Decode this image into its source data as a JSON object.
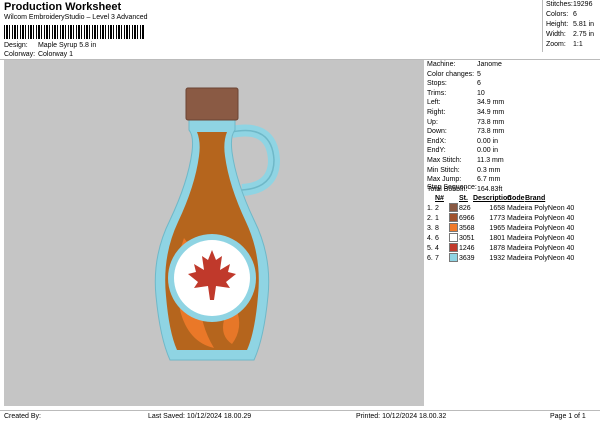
{
  "header": {
    "title": "Production Worksheet",
    "subtitle": "Wilcom EmbroideryStudio – Level 3 Advanced",
    "design_label": "Design:",
    "design_value": "Maple Syrup 5.8 in",
    "colorway_label": "Colorway:",
    "colorway_value": "Colorway 1"
  },
  "stats": [
    {
      "label": "Stitches:",
      "value": "19296"
    },
    {
      "label": "Colors:",
      "value": "6"
    },
    {
      "label": "Height:",
      "value": "5.81 in"
    },
    {
      "label": "Width:",
      "value": "2.75 in"
    },
    {
      "label": "Zoom:",
      "value": "1:1"
    }
  ],
  "info": [
    {
      "label": "Machine:",
      "value": "Janome"
    },
    {
      "label": "Color changes:",
      "value": "5"
    },
    {
      "label": "Stops:",
      "value": "6"
    },
    {
      "label": "Trims:",
      "value": "10"
    },
    {
      "label": "Left:",
      "value": "34.9 mm"
    },
    {
      "label": "Right:",
      "value": "34.9 mm"
    },
    {
      "label": "Up:",
      "value": "73.8 mm"
    },
    {
      "label": "Down:",
      "value": "73.8 mm"
    },
    {
      "label": "EndX:",
      "value": "0.00 in"
    },
    {
      "label": "EndY:",
      "value": "0.00 in"
    },
    {
      "label": "Max Stitch:",
      "value": "11.3 mm"
    },
    {
      "label": "Min Stitch:",
      "value": "0.3 mm"
    },
    {
      "label": "Max Jump:",
      "value": "6.7 mm"
    },
    {
      "label": "Total Bobbin:",
      "value": "164.83ft"
    }
  ],
  "sequence": {
    "title": "Stop Sequence:",
    "headers": [
      "N#",
      "St.",
      "Description",
      "Code",
      "Brand"
    ],
    "rows": [
      {
        "stop": "1.",
        "num": "2",
        "color": "#8a5a44",
        "code": "826",
        "stitches": "1658",
        "brand": "Madeira PolyNeon 40"
      },
      {
        "stop": "2.",
        "num": "1",
        "color": "#a0522d",
        "code": "6966",
        "stitches": "1773",
        "brand": "Madeira PolyNeon 40"
      },
      {
        "stop": "3.",
        "num": "8",
        "color": "#f07a2a",
        "code": "3568",
        "stitches": "1965",
        "brand": "Madeira PolyNeon 40"
      },
      {
        "stop": "4.",
        "num": "6",
        "color": "#ffffff",
        "code": "3051",
        "stitches": "1801",
        "brand": "Madeira PolyNeon 40"
      },
      {
        "stop": "5.",
        "num": "4",
        "color": "#c0392b",
        "code": "1246",
        "stitches": "1878",
        "brand": "Madeira PolyNeon 40"
      },
      {
        "stop": "6.",
        "num": "7",
        "color": "#8fd4e3",
        "code": "3639",
        "stitches": "1932",
        "brand": "Madeira PolyNeon 40"
      }
    ]
  },
  "footer": {
    "created": "Created By:",
    "saved": "Last Saved: 10/12/2024 18.00.29",
    "printed": "Printed: 10/12/2024 18.00.32",
    "page": "Page 1 of 1"
  },
  "colors": {
    "cap": "#8a5a44",
    "syrup": "#b5651d",
    "syrup_light": "#f07a2a",
    "glass": "#8fd4e3",
    "label": "#ffffff",
    "leaf": "#c0392b",
    "background": "#c5c5c5"
  }
}
